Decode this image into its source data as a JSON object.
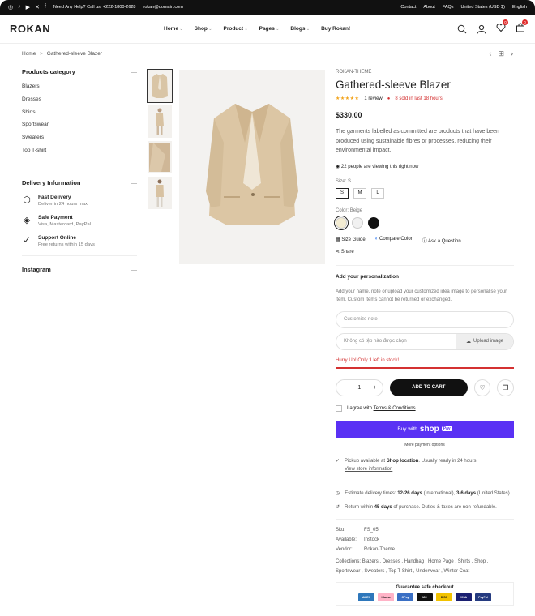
{
  "topbar": {
    "help": "Need Any Help? Call us: +222-1800-2628",
    "email": "rokan@domain.com",
    "links": [
      "Contact",
      "About",
      "FAQs",
      "United States (USD $)",
      "English"
    ]
  },
  "header": {
    "logo": "ROKAN",
    "nav": [
      "Home",
      "Shop",
      "Product",
      "Pages",
      "Blogs",
      "Buy Rokan!"
    ],
    "wishlist_count": "0",
    "cart_count": "0"
  },
  "breadcrumb": {
    "home": "Home",
    "sep": ">",
    "current": "Gathered-sleeve Blazer"
  },
  "sidebar": {
    "categories_title": "Products category",
    "categories": [
      "Blazers",
      "Dresses",
      "Shirts",
      "Sportswear",
      "Sweaters",
      "Top T-shirt"
    ],
    "delivery_title": "Delivery Information",
    "delivery": [
      {
        "title": "Fast Delivery",
        "sub": "Deliver in 24 hours max!",
        "icon": "box-icon"
      },
      {
        "title": "Safe Payment",
        "sub": "Visa, Mastercard, PayPal...",
        "icon": "payment-icon"
      },
      {
        "title": "Support Online",
        "sub": "Free returns within 15 days",
        "icon": "support-icon"
      }
    ],
    "instagram_title": "Instagram",
    "toggle": "—"
  },
  "product": {
    "brand": "ROKAN-THEME",
    "title": "Gathered-sleeve Blazer",
    "stars": "★★★★★",
    "reviews": "1 review",
    "sold": "8 sold in last 18 hours",
    "price": "$330.00",
    "description": "The garments labelled as committed are products that have been produced using sustainable fibres or processes, reducing their environmental impact.",
    "viewing": "22 people are viewing this right now",
    "size_label": "Size:",
    "size_value": "S",
    "sizes": [
      "S",
      "M",
      "L"
    ],
    "color_label": "Color:",
    "color_value": "Beige",
    "colors": [
      "#f3ecd2",
      "#f1f1f1",
      "#111111"
    ],
    "size_guide": "Size Guide",
    "compare": "Compare Color",
    "ask": "Ask a Question",
    "share": "Share"
  },
  "personalization": {
    "title": "Add your personalization",
    "text": "Add your name, note or upload your customized idea image to personalise your item. Custom items cannot be returned or exchanged.",
    "note_placeholder": "Customize note",
    "file_text": "Không có tệp nào được chọn",
    "upload_label": "Upload image"
  },
  "stock": {
    "prefix": "Hurry Up! Only ",
    "count": "1",
    "suffix": " left in stock!"
  },
  "cart": {
    "qty": "1",
    "add": "ADD TO CART",
    "minus": "−",
    "plus": "+"
  },
  "agree": {
    "text": "I agree with ",
    "link": "Terms & Conditions"
  },
  "shoppay": {
    "prefix": "Buy with",
    "brand": "shop",
    "pay": "Pay",
    "more": "More payment options"
  },
  "shipping": {
    "pickup_prefix": "Pickup available at ",
    "pickup_bold": "Shop location",
    "pickup_suffix": ". Usually ready in 24 hours",
    "store_info": "View store information",
    "est_prefix": "Estimate delivery times: ",
    "est_intl": "12-26 days",
    "est_intl_suffix": " (International), ",
    "est_us": "3-6 days",
    "est_us_suffix": " (United States).",
    "ret_prefix": "Return within ",
    "ret_bold": "45 days",
    "ret_suffix": " of purchase. Duties & taxes are non-refundable."
  },
  "meta": {
    "sku_k": "Sku:",
    "sku_v": "FS_05",
    "avail_k": "Available:",
    "avail_v": "Instock",
    "vendor_k": "Vendor:",
    "vendor_v": "Rokan-Theme",
    "collections_k": "Collections:",
    "collections_v": "Blazers , Dresses , Handbag , Home Page , Shirts , Shop , Sportswear , Sweaters , Top T-Shirt , Underwear , Winter Coat"
  },
  "guarantee": {
    "title": "Guarantee safe checkout",
    "cards": [
      "AMEX",
      "Klarna",
      "GPay",
      "MC",
      "DISC",
      "VISA",
      "PayPal"
    ]
  }
}
